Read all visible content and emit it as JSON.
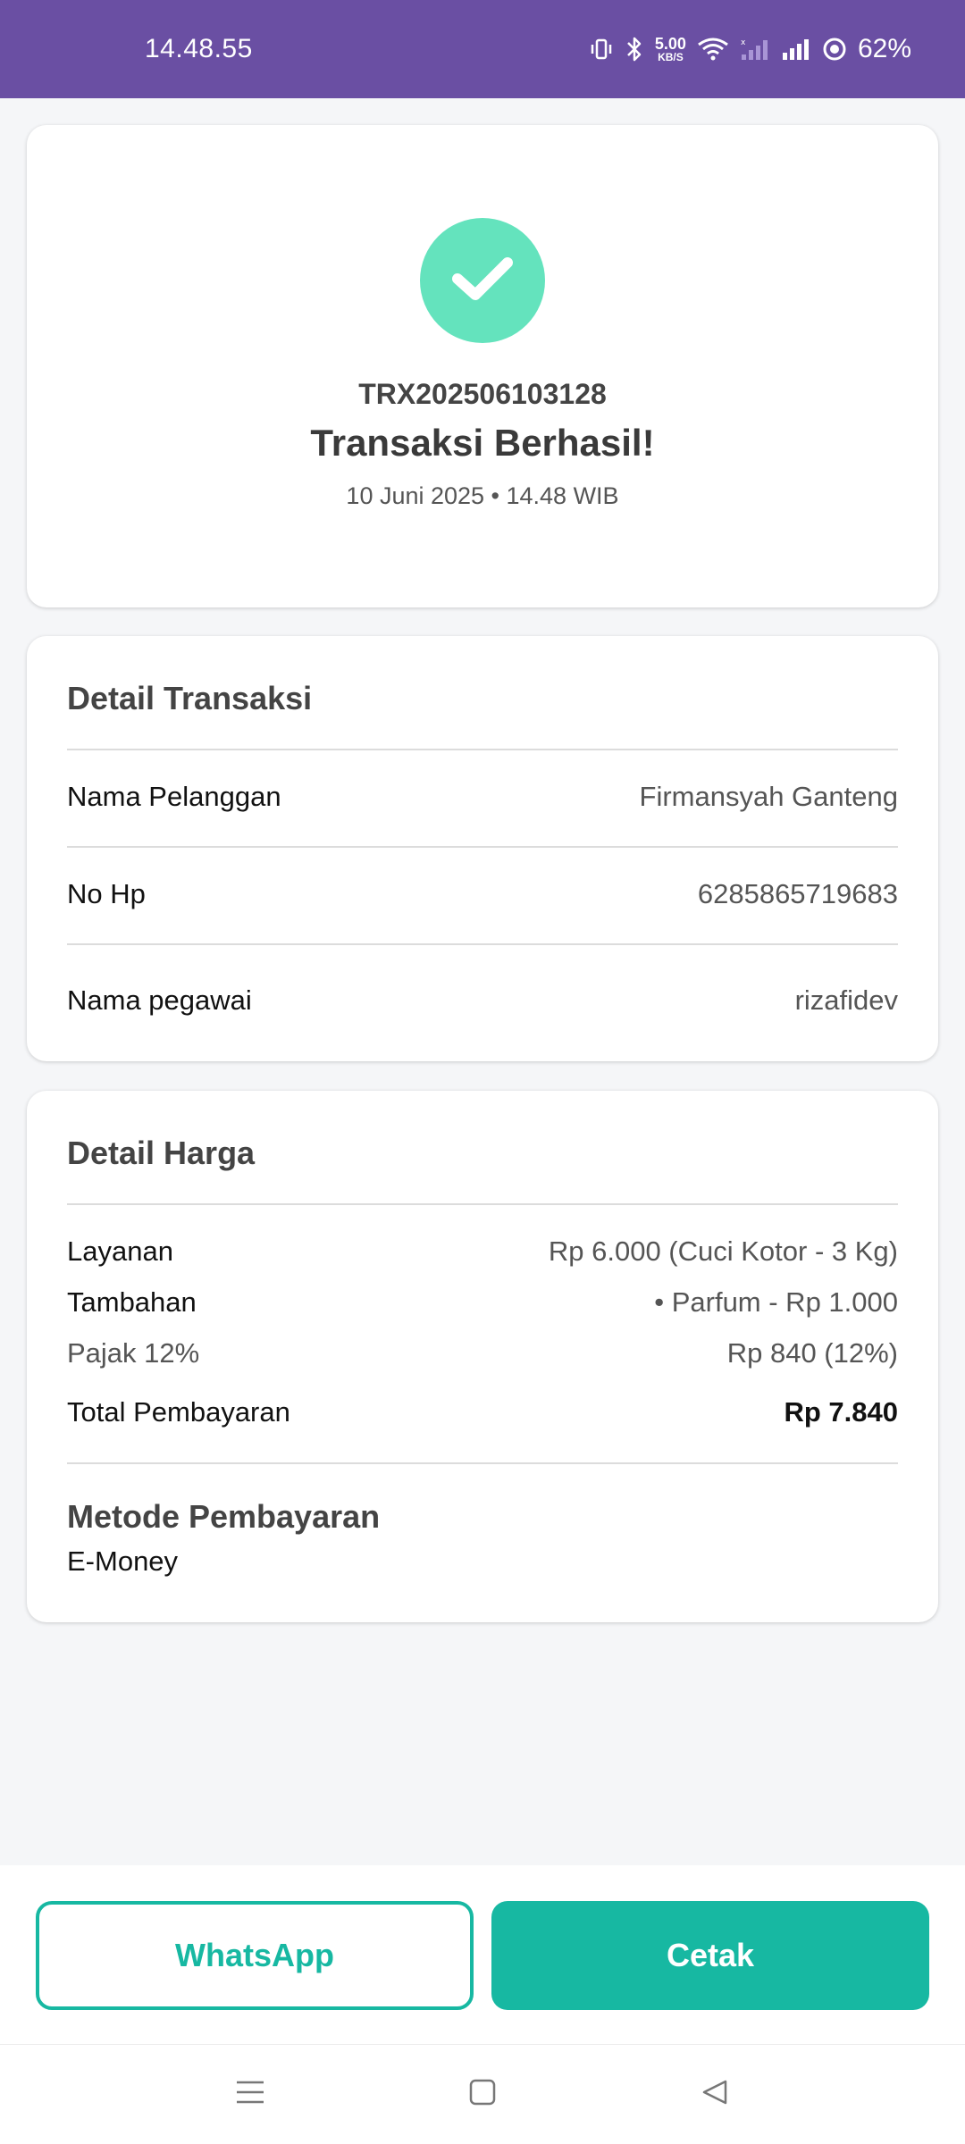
{
  "status_bar": {
    "time": "14.48.55",
    "net_speed_value": "5.00",
    "net_speed_unit": "KB/S",
    "battery": "62%"
  },
  "success": {
    "icon": "check-icon",
    "trx_code": "TRX202506103128",
    "title": "Transaksi Berhasil!",
    "datetime": "10 Juni 2025 • 14.48 WIB",
    "accent_color": "#64e3bd"
  },
  "detail": {
    "title": "Detail Transaksi",
    "rows": [
      {
        "label": "Nama Pelanggan",
        "value": "Firmansyah Ganteng"
      },
      {
        "label": "No Hp",
        "value": "6285865719683"
      },
      {
        "label": "Nama pegawai",
        "value": "rizafidev"
      }
    ]
  },
  "harga": {
    "title": "Detail Harga",
    "rows": [
      {
        "label": "Layanan",
        "value": "Rp 6.000 (Cuci Kotor - 3 Kg)"
      },
      {
        "label": "Tambahan",
        "value": "• Parfum - Rp 1.000"
      },
      {
        "label": "Pajak 12%",
        "value": "Rp 840 (12%)"
      }
    ],
    "total_label": "Total Pembayaran",
    "total_value": "Rp 7.840",
    "method_title": "Metode Pembayaran",
    "method_value": "E-Money"
  },
  "actions": {
    "whatsapp_label": "WhatsApp",
    "print_label": "Cetak",
    "brand_color": "#17b8a2"
  },
  "nav": {
    "recents_icon": "menu-icon",
    "home_icon": "square-icon",
    "back_icon": "back-triangle-icon"
  }
}
